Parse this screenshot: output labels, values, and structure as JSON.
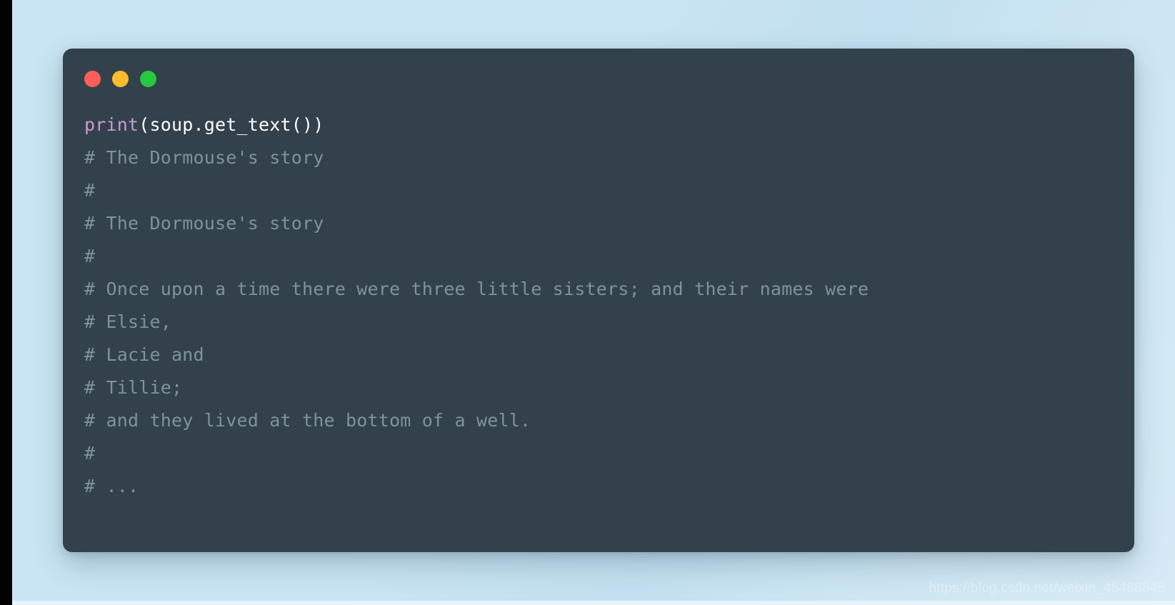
{
  "window": {
    "traffic_lights": [
      {
        "name": "close-dot",
        "color": "#ff5f56"
      },
      {
        "name": "minimize-dot",
        "color": "#ffbd2e"
      },
      {
        "name": "maximize-dot",
        "color": "#27c93f"
      }
    ],
    "card_background": "#32414b",
    "page_background": "#c9e4f2"
  },
  "code": {
    "source_line": {
      "function": "print",
      "rest": "(soup.get_text())"
    },
    "output_lines": [
      "# The Dormouse's story",
      "#",
      "# The Dormouse's story",
      "#",
      "# Once upon a time there were three little sisters; and their names were",
      "# Elsie,",
      "# Lacie and",
      "# Tillie;",
      "# and they lived at the bottom of a well.",
      "#",
      "# ..."
    ],
    "source_color": "#ffffff",
    "function_color": "#cb9ad4",
    "comment_color": "#7d939c"
  },
  "watermark": {
    "text": "https://blog.csdn.net/weixin_45468845"
  }
}
